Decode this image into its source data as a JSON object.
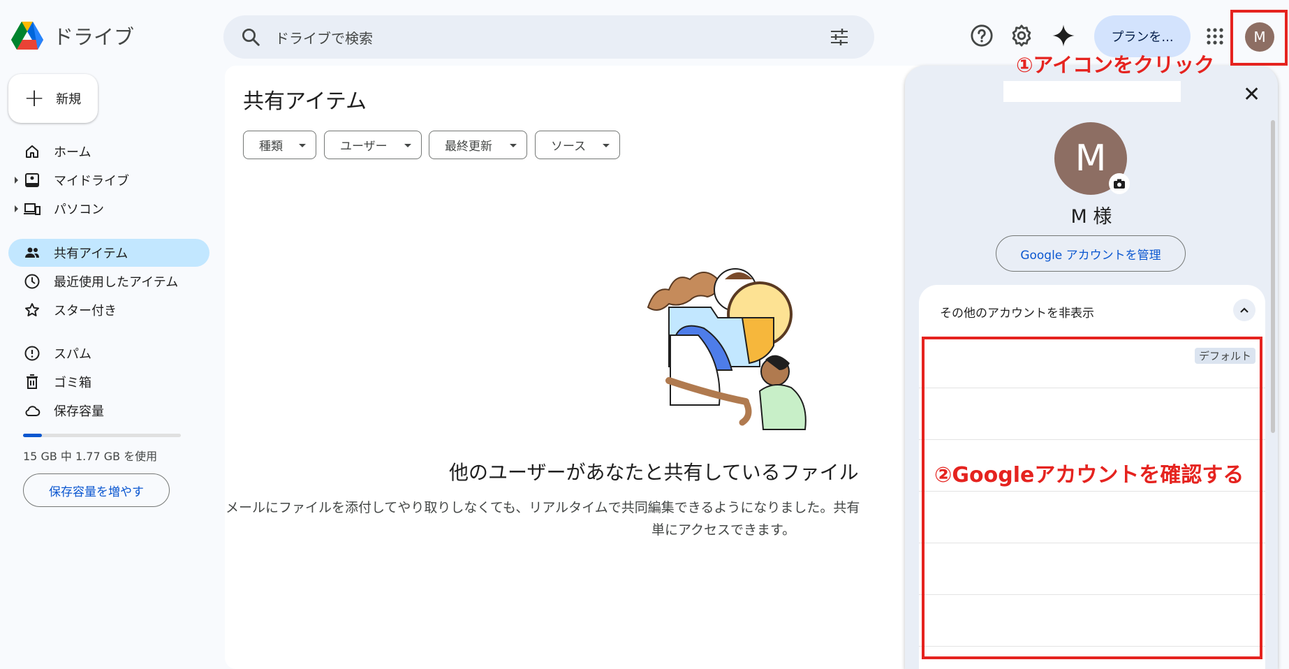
{
  "app": {
    "title": "ドライブ"
  },
  "search": {
    "placeholder": "ドライブで検索"
  },
  "toolbar": {
    "help_icon": "help-circle-icon",
    "settings_icon": "gear-icon",
    "gemini_icon": "sparkle-icon",
    "plan_button": "プランを...",
    "apps_icon": "apps-grid-icon",
    "avatar_initial": "M"
  },
  "sidebar": {
    "new_button": "新規",
    "items": [
      {
        "label": "ホーム",
        "icon": "home-icon"
      },
      {
        "label": "マイドライブ",
        "icon": "my-drive-icon"
      },
      {
        "label": "パソコン",
        "icon": "computers-icon"
      },
      {
        "label": "共有アイテム",
        "icon": "shared-people-icon"
      },
      {
        "label": "最近使用したアイテム",
        "icon": "clock-icon"
      },
      {
        "label": "スター付き",
        "icon": "star-icon"
      },
      {
        "label": "スパム",
        "icon": "spam-icon"
      },
      {
        "label": "ゴミ箱",
        "icon": "trash-icon"
      },
      {
        "label": "保存容量",
        "icon": "cloud-icon"
      }
    ],
    "storage_used_fraction": 0.118,
    "storage_text": "15 GB 中 1.77 GB を使用",
    "more_storage_button": "保存容量を増やす"
  },
  "main": {
    "title": "共有アイテム",
    "filters": [
      "種類",
      "ユーザー",
      "最終更新",
      "ソース"
    ],
    "empty_title": "他のユーザーがあなたと共有しているファイル",
    "empty_desc_line1": "メールにファイルを添付してやり取りしなくても、リアルタイムで共同編集できるようになりました。共有",
    "empty_desc_line2": "単にアクセスできます。"
  },
  "account_panel": {
    "avatar_initial": "M",
    "name": "M 様",
    "manage_button": "Google アカウントを管理",
    "others_label": "その他のアカウントを非表示",
    "default_badge": "デフォルト"
  },
  "annotations": {
    "step1": "①アイコンをクリック",
    "step2": "②Googleアカウントを確認する",
    "color": "#e5231f"
  }
}
